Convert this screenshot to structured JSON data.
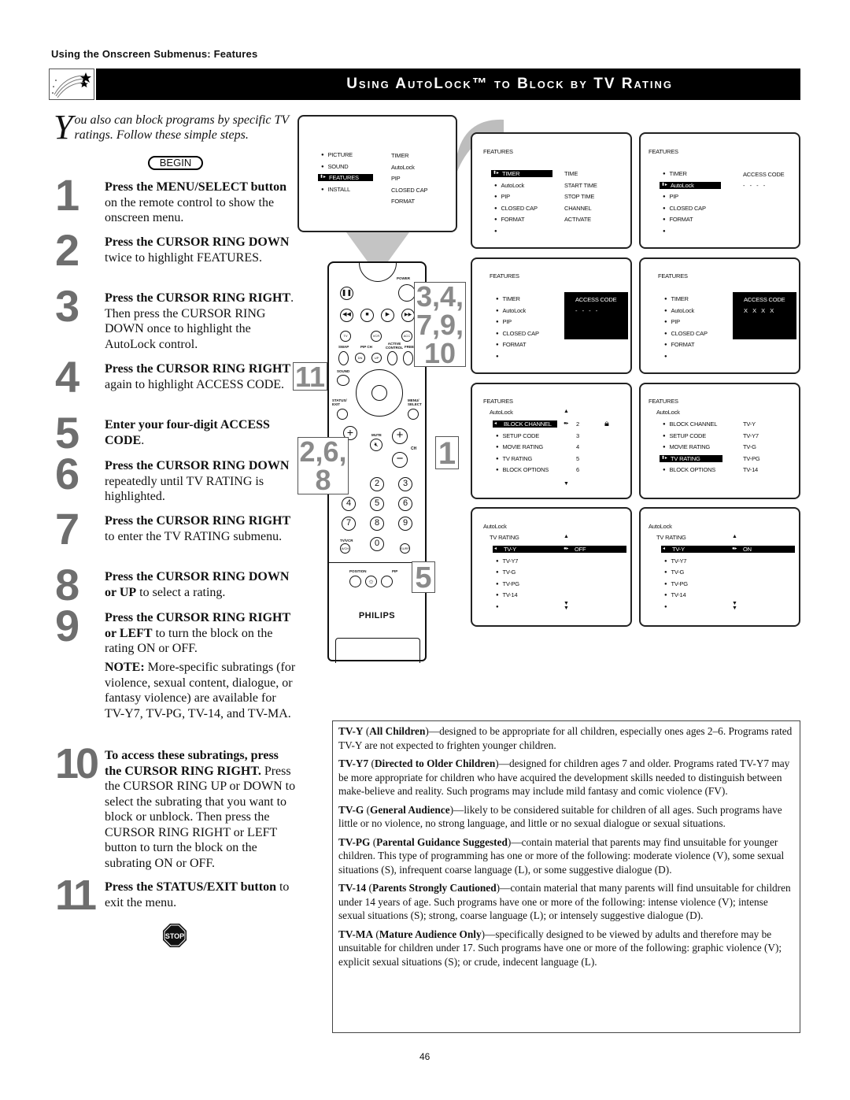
{
  "page": {
    "section_header": "Using the Onscreen Submenus: Features",
    "title": "Using AutoLock™ to Block by TV Rating",
    "page_number": "46"
  },
  "intro": {
    "drop_cap": "Y",
    "text": "ou also can block programs by specific TV ratings. Follow these simple steps.",
    "begin_label": "BEGIN"
  },
  "steps": [
    {
      "num": "1",
      "bold": "Press the MENU/SELECT button",
      "rest": " on the remote control to show the onscreen menu."
    },
    {
      "num": "2",
      "bold": "Press the CURSOR RING DOWN",
      "rest": " twice to highlight FEATURES."
    },
    {
      "num": "3",
      "bold": "Press the CURSOR RING RIGHT",
      "rest": ". Then press the CURSOR RING DOWN once to highlight the AutoLock control."
    },
    {
      "num": "4",
      "bold": "Press the CURSOR RING RIGHT",
      "rest": " again to highlight ACCESS CODE."
    },
    {
      "num": "5",
      "bold": "Enter your four-digit ACCESS CODE",
      "rest": "."
    },
    {
      "num": "6",
      "bold": "Press the CURSOR RING DOWN",
      "rest": " repeatedly until TV RATING is highlighted."
    },
    {
      "num": "7",
      "bold": "Press the CURSOR RING RIGHT",
      "rest": " to enter the TV RATING submenu."
    },
    {
      "num": "8",
      "bold": "Press the CURSOR RING DOWN or UP",
      "rest": " to select a rating."
    },
    {
      "num": "9",
      "bold": "Press the CURSOR RING RIGHT or LEFT",
      "rest": " to turn the block on the rating ON or OFF."
    },
    {
      "num": "10",
      "bold": "To access these subratings, press the CURSOR RING RIGHT.",
      "rest": " Press the CURSOR RING UP or DOWN to select the subrating that you want to block or unblock. Then press the CURSOR RING RIGHT or LEFT button to turn the block on the subrating ON or OFF."
    },
    {
      "num": "11",
      "bold": "Press the STATUS/EXIT button",
      "rest": " to exit the menu."
    }
  ],
  "note": {
    "bold": "NOTE:",
    "rest": " More-specific subratings (for violence, sexual content, dialogue, or fantasy violence) are available for TV-Y7, TV-PG, TV-14, and TV-MA."
  },
  "stop_label": "STOP",
  "screens": {
    "main_menu": {
      "left": [
        "PICTURE",
        "SOUND",
        "FEATURES",
        "INSTALL"
      ],
      "right": [
        "TIMER",
        "AutoLock",
        "PIP",
        "CLOSED CAP",
        "FORMAT"
      ],
      "selected": "FEATURES"
    },
    "features_timer": {
      "title": "FEATURES",
      "left": [
        "TIMER",
        "AutoLock",
        "PIP",
        "CLOSED CAP",
        "FORMAT"
      ],
      "right": [
        "TIME",
        "START TIME",
        "STOP TIME",
        "CHANNEL",
        "ACTIVATE"
      ],
      "selected": "TIMER"
    },
    "features_autolock": {
      "title": "FEATURES",
      "left": [
        "TIMER",
        "AutoLock",
        "PIP",
        "CLOSED CAP",
        "FORMAT"
      ],
      "right_label": "ACCESS CODE",
      "right_value": "- - - -",
      "selected": "AutoLock"
    },
    "access_code_empty": {
      "title": "FEATURES",
      "left": [
        "TIMER",
        "AutoLock",
        "PIP",
        "CLOSED CAP",
        "FORMAT"
      ],
      "panel_label": "ACCESS CODE",
      "panel_value": "- - - -"
    },
    "access_code_entered": {
      "title": "FEATURES",
      "left": [
        "TIMER",
        "AutoLock",
        "PIP",
        "CLOSED CAP",
        "FORMAT"
      ],
      "panel_label": "ACCESS CODE",
      "panel_value": "X X X X"
    },
    "autolock_menu": {
      "title": "FEATURES",
      "subtitle": "AutoLock",
      "items": [
        "BLOCK CHANNEL",
        "SETUP CODE",
        "MOVIE RATING",
        "TV RATING",
        "BLOCK OPTIONS"
      ],
      "values": [
        "2",
        "3",
        "4",
        "5",
        "6"
      ],
      "selected": "BLOCK CHANNEL"
    },
    "autolock_tvrating": {
      "title": "FEATURES",
      "subtitle": "AutoLock",
      "items": [
        "BLOCK CHANNEL",
        "SETUP CODE",
        "MOVIE RATING",
        "TV RATING",
        "BLOCK OPTIONS"
      ],
      "values": [
        "TV-Y",
        "TV-Y7",
        "TV-G",
        "TV-PG",
        "TV-14"
      ],
      "selected": "TV RATING"
    },
    "tvrating_off": {
      "title": "AutoLock",
      "subtitle": "TV RATING",
      "items": [
        "TV-Y",
        "TV-Y7",
        "TV-G",
        "TV-PG",
        "TV-14"
      ],
      "state": "OFF"
    },
    "tvrating_on": {
      "title": "AutoLock",
      "subtitle": "TV RATING",
      "items": [
        "TV-Y",
        "TV-Y7",
        "TV-G",
        "TV-PG",
        "TV-14"
      ],
      "state": "ON"
    }
  },
  "remote": {
    "brand": "PHILIPS",
    "labels": {
      "power": "POWER",
      "tv": "TV",
      "vcr": "VCR",
      "acc": "ACC",
      "swap": "SWAP",
      "pipch": "PIP CH",
      "dn": "DN",
      "up": "UP",
      "active": "ACTIVE CONTROL",
      "freeze": "FREEZE",
      "sound": "SOUND",
      "status": "STATUS/ EXIT",
      "menu": "MENU/ SELECT",
      "mute": "MUTE",
      "ch": "CH",
      "tvvcr": "TV/VCR",
      "ach": "A/CH",
      "surf": "SURF",
      "position": "POSITION",
      "pip": "PIP"
    },
    "digits": [
      "2",
      "3",
      "4",
      "5",
      "6",
      "7",
      "8",
      "9",
      "0"
    ],
    "callouts": {
      "c1": "3,4,\n7,9,\n10",
      "c2": "11",
      "c3": "2,6,\n8",
      "c4": "1",
      "c5": "5"
    }
  },
  "ratings": [
    {
      "code": "TV-Y",
      "name": "All Children",
      "text": "—designed to be appropriate for all children, especially ones ages 2–6. Programs rated TV-Y are not expected to frighten younger children."
    },
    {
      "code": "TV-Y7",
      "name": "Directed to Older Children",
      "text": "—designed for children ages 7 and older. Programs rated TV-Y7 may be more appropriate for children who have acquired the development skills needed to distinguish between make-believe and reality. Such programs may include mild fantasy and comic violence (FV)."
    },
    {
      "code": "TV-G",
      "name": "General Audience",
      "text": "—likely to be considered suitable for children of all ages. Such programs have little or no violence, no strong language, and little or no sexual dialogue or sexual situations."
    },
    {
      "code": "TV-PG",
      "name": "Parental Guidance Suggested",
      "text": "—contain material that parents may find unsuitable for younger children. This type of programming has one or more of the following: moderate violence (V), some sexual situations (S), infrequent coarse language (L), or some suggestive dialogue (D)."
    },
    {
      "code": "TV-14",
      "name": "Parents Strongly Cautioned",
      "text": "—contain material that many parents will find unsuitable for children under 14 years of age. Such programs have one or more of the following: intense violence (V); intense sexual situations (S); strong, coarse language (L); or intensely suggestive dialogue (D)."
    },
    {
      "code": "TV-MA",
      "name": "Mature Audience Only",
      "text": "—specifically designed to be viewed by adults and therefore may be unsuitable for children under 17. Such programs have one or more of the following: graphic violence (V); explicit sexual situations (S); or crude, indecent language (L)."
    }
  ]
}
